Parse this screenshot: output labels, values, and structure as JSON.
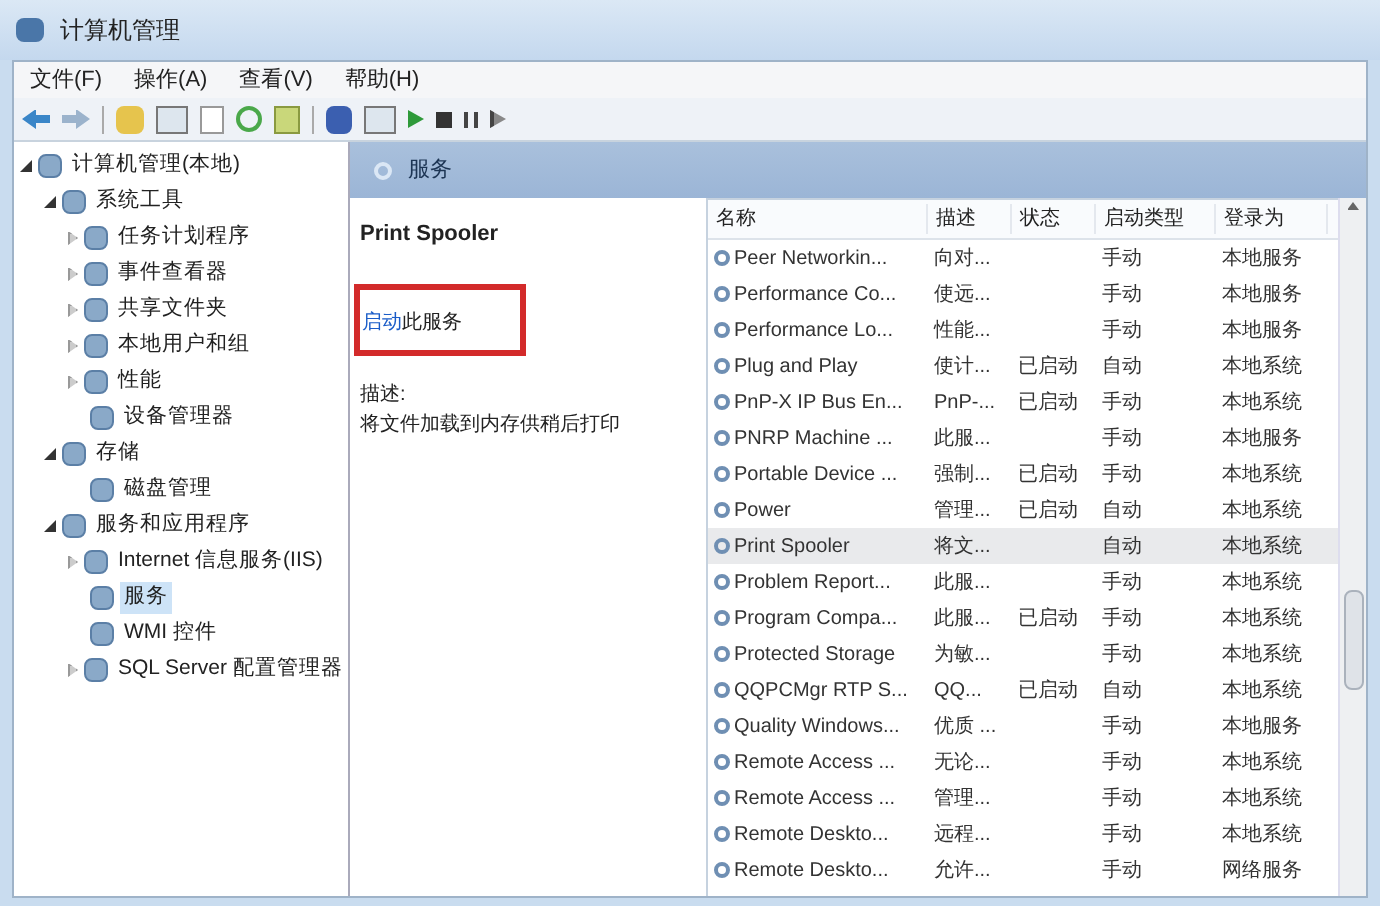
{
  "window": {
    "title": "计算机管理"
  },
  "menu": [
    "文件(F)",
    "操作(A)",
    "查看(V)",
    "帮助(H)"
  ],
  "tree": [
    {
      "label": "计算机管理(本地)",
      "expanded": true,
      "selected": false,
      "children": [
        {
          "label": "系统工具",
          "expanded": true,
          "selected": false,
          "children": [
            {
              "label": "任务计划程序",
              "expanded": false,
              "selected": false
            },
            {
              "label": "事件查看器",
              "expanded": false,
              "selected": false
            },
            {
              "label": "共享文件夹",
              "expanded": false,
              "selected": false
            },
            {
              "label": "本地用户和组",
              "expanded": false,
              "selected": false
            },
            {
              "label": "性能",
              "expanded": false,
              "selected": false
            },
            {
              "label": "设备管理器",
              "selected": false
            }
          ]
        },
        {
          "label": "存储",
          "expanded": true,
          "selected": false,
          "children": [
            {
              "label": "磁盘管理",
              "selected": false
            }
          ]
        },
        {
          "label": "服务和应用程序",
          "expanded": true,
          "selected": false,
          "children": [
            {
              "label": "Internet 信息服务(IIS)",
              "expanded": false,
              "selected": false
            },
            {
              "label": "服务",
              "selected": true
            },
            {
              "label": "WMI 控件",
              "selected": false
            },
            {
              "label": "SQL Server 配置管理器",
              "expanded": false,
              "selected": false
            }
          ]
        }
      ]
    }
  ],
  "panel": {
    "title": "服务",
    "service_name": "Print Spooler",
    "action_link": "启动",
    "action_text": "此服务",
    "description_label": "描述:",
    "description": "将文件加载到内存供稍后打印"
  },
  "table": {
    "columns": [
      "名称",
      "描述",
      "状态",
      "启动类型",
      "登录为"
    ],
    "rows": [
      {
        "cells": [
          "Peer Networkin...",
          "向对...",
          "",
          "手动",
          "本地服务"
        ],
        "selected": false
      },
      {
        "cells": [
          "Performance Co...",
          "使远...",
          "",
          "手动",
          "本地服务"
        ],
        "selected": false
      },
      {
        "cells": [
          "Performance Lo...",
          "性能...",
          "",
          "手动",
          "本地服务"
        ],
        "selected": false
      },
      {
        "cells": [
          "Plug and Play",
          "使计...",
          "已启动",
          "自动",
          "本地系统"
        ],
        "selected": false
      },
      {
        "cells": [
          "PnP-X IP Bus En...",
          "PnP-...",
          "已启动",
          "手动",
          "本地系统"
        ],
        "selected": false
      },
      {
        "cells": [
          "PNRP Machine ...",
          "此服...",
          "",
          "手动",
          "本地服务"
        ],
        "selected": false
      },
      {
        "cells": [
          "Portable Device ...",
          "强制...",
          "已启动",
          "手动",
          "本地系统"
        ],
        "selected": false
      },
      {
        "cells": [
          "Power",
          "管理...",
          "已启动",
          "自动",
          "本地系统"
        ],
        "selected": false
      },
      {
        "cells": [
          "Print Spooler",
          "将文...",
          "",
          "自动",
          "本地系统"
        ],
        "selected": true
      },
      {
        "cells": [
          "Problem Report...",
          "此服...",
          "",
          "手动",
          "本地系统"
        ],
        "selected": false
      },
      {
        "cells": [
          "Program Compa...",
          "此服...",
          "已启动",
          "手动",
          "本地系统"
        ],
        "selected": false
      },
      {
        "cells": [
          "Protected Storage",
          "为敏...",
          "",
          "手动",
          "本地系统"
        ],
        "selected": false
      },
      {
        "cells": [
          "QQPCMgr RTP S...",
          "QQ...",
          "已启动",
          "自动",
          "本地系统"
        ],
        "selected": false
      },
      {
        "cells": [
          "Quality Windows...",
          "优质 ...",
          "",
          "手动",
          "本地服务"
        ],
        "selected": false
      },
      {
        "cells": [
          "Remote Access ...",
          "无论...",
          "",
          "手动",
          "本地系统"
        ],
        "selected": false
      },
      {
        "cells": [
          "Remote Access ...",
          "管理...",
          "",
          "手动",
          "本地系统"
        ],
        "selected": false
      },
      {
        "cells": [
          "Remote Deskto...",
          "远程...",
          "",
          "手动",
          "本地系统"
        ],
        "selected": false
      },
      {
        "cells": [
          "Remote Deskto...",
          "允许...",
          "",
          "手动",
          "网络服务"
        ],
        "selected": false
      }
    ]
  }
}
